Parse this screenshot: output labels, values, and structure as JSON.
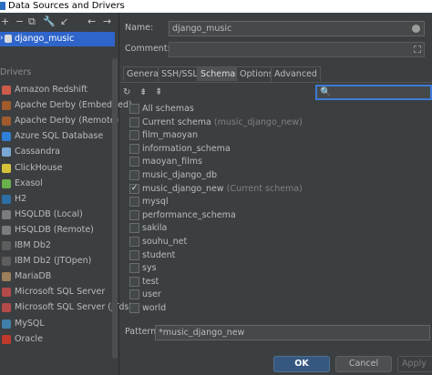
{
  "window": {
    "title": "Data Sources and Drivers"
  },
  "sidebar": {
    "toolbar_icons": [
      "+",
      "−",
      "⧉",
      "🔧",
      "↙",
      "←",
      "→"
    ],
    "data_source": "django_music",
    "drivers_header": "Drivers",
    "drivers": [
      {
        "label": "Amazon Redshift",
        "color": "#cc5b4a"
      },
      {
        "label": "Apache Derby (Embedded)",
        "color": "#a05a2c"
      },
      {
        "label": "Apache Derby (Remote)",
        "color": "#a05a2c"
      },
      {
        "label": "Azure SQL Database",
        "color": "#2f7fd6"
      },
      {
        "label": "Cassandra",
        "color": "#7aa7d6"
      },
      {
        "label": "ClickHouse",
        "color": "#d6c23a"
      },
      {
        "label": "Exasol",
        "color": "#6ab04c"
      },
      {
        "label": "H2",
        "color": "#2d6fa5"
      },
      {
        "label": "HSQLDB (Local)",
        "color": "#7c7c7c"
      },
      {
        "label": "HSQLDB (Remote)",
        "color": "#7c7c7c"
      },
      {
        "label": "IBM Db2",
        "color": "#5d5d5d"
      },
      {
        "label": "IBM Db2 (JTOpen)",
        "color": "#5d5d5d"
      },
      {
        "label": "MariaDB",
        "color": "#9c7f5a"
      },
      {
        "label": "Microsoft SQL Server",
        "color": "#b34a4a"
      },
      {
        "label": "Microsoft SQL Server (jTds)",
        "color": "#b34a4a"
      },
      {
        "label": "MySQL",
        "color": "#3f7fa8"
      },
      {
        "label": "Oracle",
        "color": "#c0392b"
      }
    ]
  },
  "form": {
    "name_label": "Name:",
    "name_value": "django_music",
    "comment_label": "Comment:"
  },
  "tabs": [
    "General",
    "SSH/SSL",
    "Schemas",
    "Options",
    "Advanced"
  ],
  "active_tab": "Schemas",
  "schemas_toolbar": {
    "refresh": "↻",
    "expand": "⇟",
    "collapse": "⇞"
  },
  "schemas": {
    "items": [
      {
        "label": "All schemas",
        "checked": false,
        "suffix": ""
      },
      {
        "label": "Current schema",
        "checked": false,
        "suffix": "(music_django_new)"
      },
      {
        "label": "film_maoyan",
        "checked": false,
        "suffix": ""
      },
      {
        "label": "information_schema",
        "checked": false,
        "suffix": ""
      },
      {
        "label": "maoyan_films",
        "checked": false,
        "suffix": ""
      },
      {
        "label": "music_django_db",
        "checked": false,
        "suffix": ""
      },
      {
        "label": "music_django_new",
        "checked": true,
        "suffix": "(Current schema)"
      },
      {
        "label": "mysql",
        "checked": false,
        "suffix": ""
      },
      {
        "label": "performance_schema",
        "checked": false,
        "suffix": ""
      },
      {
        "label": "sakila",
        "checked": false,
        "suffix": ""
      },
      {
        "label": "souhu_net",
        "checked": false,
        "suffix": ""
      },
      {
        "label": "student",
        "checked": false,
        "suffix": ""
      },
      {
        "label": "sys",
        "checked": false,
        "suffix": ""
      },
      {
        "label": "test",
        "checked": false,
        "suffix": ""
      },
      {
        "label": "user",
        "checked": false,
        "suffix": ""
      },
      {
        "label": "world",
        "checked": false,
        "suffix": ""
      }
    ]
  },
  "pattern": {
    "label": "Pattern:",
    "value": "*music_django_new"
  },
  "buttons": {
    "ok": "OK",
    "cancel": "Cancel",
    "apply": "Apply"
  }
}
